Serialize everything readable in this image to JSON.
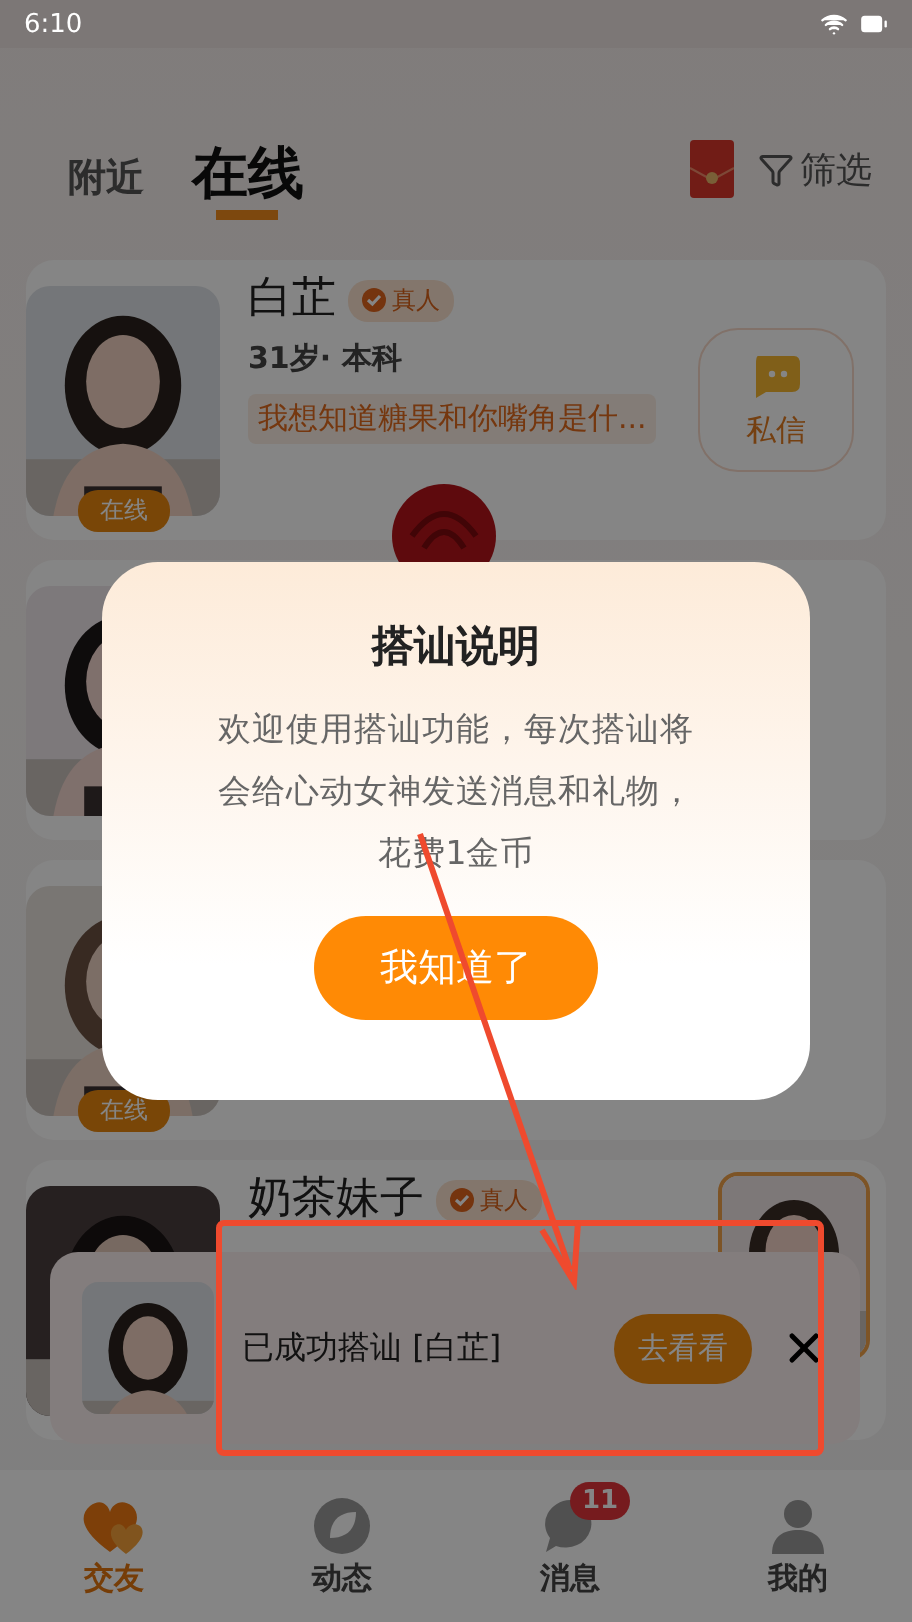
{
  "status_bar": {
    "time": "6:10"
  },
  "tabs": [
    {
      "label": "附近",
      "selected": false
    },
    {
      "label": "在线",
      "selected": true
    }
  ],
  "filter": {
    "label": "筛选"
  },
  "users": [
    {
      "name": "白芷",
      "verified_label": "真人",
      "info": "31岁· 本科",
      "quote": "我想知道糖果和你嘴角是什...",
      "online_label": "在线",
      "kind": "message",
      "action_label": "私信"
    },
    {
      "kind": "plain"
    },
    {
      "online_label": "在线",
      "kind": "plain"
    },
    {
      "name": "奶茶妹子",
      "verified_label": "真人"
    }
  ],
  "dialog": {
    "title": "搭讪说明",
    "body_lines": [
      "欢迎使用搭讪功能，每次搭讪将",
      "会给心动女神发送消息和礼物，",
      "花费1金币"
    ],
    "button": "我知道了"
  },
  "toast": {
    "text": "已成功搭讪 [白芷]",
    "button": "去看看"
  },
  "nav": [
    {
      "label": "交友",
      "kind": "heart",
      "selected": true
    },
    {
      "label": "动态",
      "kind": "leaf",
      "selected": false
    },
    {
      "label": "消息",
      "kind": "chat",
      "selected": false,
      "badge": "11"
    },
    {
      "label": "我的",
      "kind": "user",
      "selected": false
    }
  ]
}
